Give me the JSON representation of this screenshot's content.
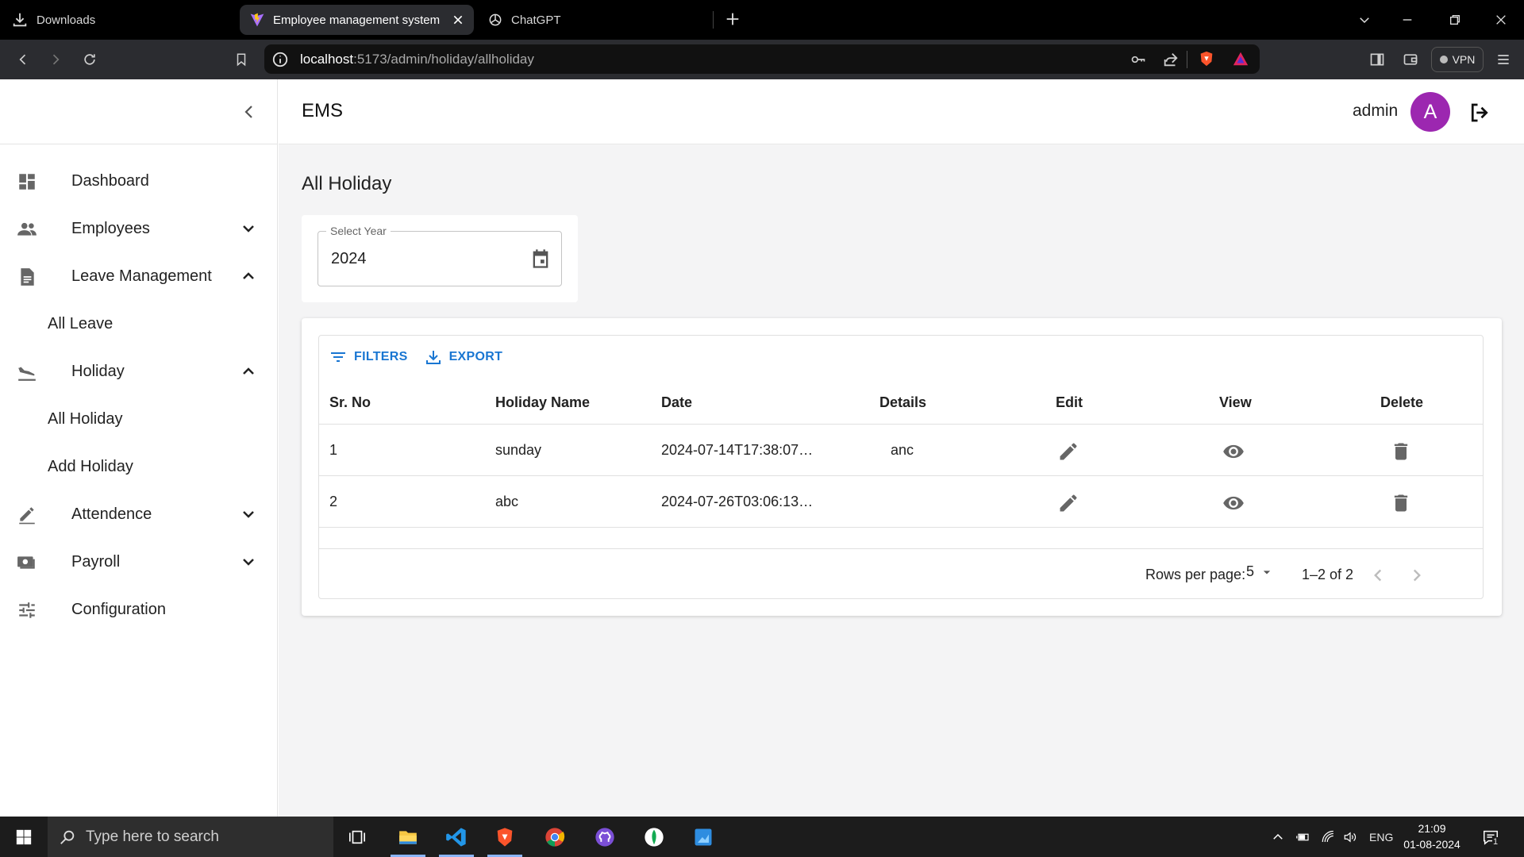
{
  "browser": {
    "downloads_label": "Downloads",
    "tabs": [
      {
        "title": "Employee management system",
        "active": true
      },
      {
        "title": "ChatGPT",
        "active": false
      }
    ],
    "url_host": "localhost",
    "url_rest": ":5173/admin/holiday/allholiday",
    "vpn_label": "VPN",
    "accent": "#fb542b"
  },
  "sidebar": {
    "items": [
      {
        "label": "Dashboard",
        "icon": "dashboard-icon"
      },
      {
        "label": "Employees",
        "icon": "people-icon",
        "chevron": "down"
      },
      {
        "label": "Leave Management",
        "icon": "document-icon",
        "chevron": "up"
      },
      {
        "label": "All Leave",
        "sub": true
      },
      {
        "label": "Holiday",
        "icon": "flight-land-icon",
        "chevron": "up"
      },
      {
        "label": "All Holiday",
        "sub": true
      },
      {
        "label": "Add Holiday",
        "sub": true
      },
      {
        "label": "Attendence",
        "icon": "edit-pen-icon",
        "chevron": "down"
      },
      {
        "label": "Payroll",
        "icon": "payments-icon",
        "chevron": "down"
      },
      {
        "label": "Configuration",
        "icon": "tune-icon"
      }
    ]
  },
  "header": {
    "brand": "EMS",
    "username": "admin",
    "avatar_letter": "A",
    "avatar_color": "#9c27b0"
  },
  "page": {
    "title": "All Holiday",
    "year_label": "Select Year",
    "year_value": "2024"
  },
  "grid": {
    "toolbar": {
      "filters": "FILTERS",
      "export": "EXPORT"
    },
    "columns": [
      "Sr. No",
      "Holiday Name",
      "Date",
      "Details",
      "Edit",
      "View",
      "Delete"
    ],
    "rows": [
      {
        "sr": "1",
        "name": "sunday",
        "date": "2024-07-14T17:38:07…",
        "details": "anc"
      },
      {
        "sr": "2",
        "name": "abc",
        "date": "2024-07-26T03:06:13…",
        "details": ""
      }
    ],
    "footer": {
      "rows_per_page_label": "Rows per page:",
      "rows_per_page_value": "5",
      "range": "1–2 of 2"
    }
  },
  "taskbar": {
    "search_placeholder": "Type here to search",
    "apps": [
      "task-view-icon",
      "file-explorer-icon",
      "vscode-icon",
      "brave-icon",
      "chrome-icon",
      "github-desktop-icon",
      "mongodb-compass-icon",
      "paint-icon"
    ],
    "language": "ENG",
    "time": "21:09",
    "date": "01-08-2024",
    "notification_count": "1"
  }
}
